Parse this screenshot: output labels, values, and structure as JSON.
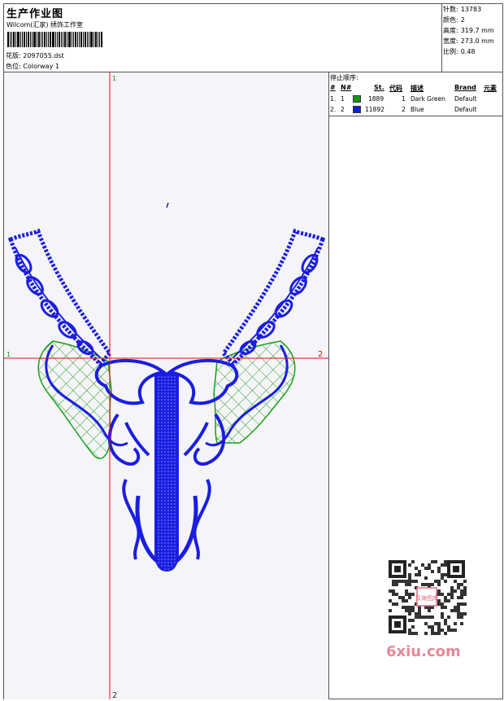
{
  "header": {
    "title": "生产作业图",
    "company": "Wilcom(汇家) 绣饰工作室",
    "design_label": "花版:",
    "design_value": "2097055.dst",
    "colorway_label": "色位:",
    "colorway_value": "Colorway 1"
  },
  "stats": [
    {
      "label": "针数:",
      "value": "13783"
    },
    {
      "label": "颜色:",
      "value": "2"
    },
    {
      "label": "高度:",
      "value": "319.7 mm"
    },
    {
      "label": "宽度:",
      "value": "273.0 mm"
    },
    {
      "label": "比例:",
      "value": "0.48"
    }
  ],
  "stop_sequence": {
    "title": "停止顺序:",
    "columns": {
      "hash": "#",
      "no": "N#",
      "st": "St.",
      "code": "代码",
      "desc": "描述",
      "brand": "Brand",
      "element": "元素"
    },
    "rows": [
      {
        "index": "1.",
        "no": "1",
        "color": "#119911",
        "stitches": "1889",
        "code": "1",
        "desc": "Dark Green",
        "brand": "Default"
      },
      {
        "index": "2.",
        "no": "2",
        "color": "#0a1ee6",
        "stitches": "11892",
        "code": "2",
        "desc": "Blue",
        "brand": "Default"
      }
    ]
  },
  "canvas": {
    "guide_labels": {
      "top": "1",
      "left": "1",
      "right": "2",
      "bottom": "2"
    },
    "guide_color": "#dd1111",
    "blue_thread": "#1a1ee0",
    "green_thread": "#1aa01a"
  },
  "watermark": {
    "qr_badge": "汉海图库",
    "logo": "6xiu.com"
  }
}
